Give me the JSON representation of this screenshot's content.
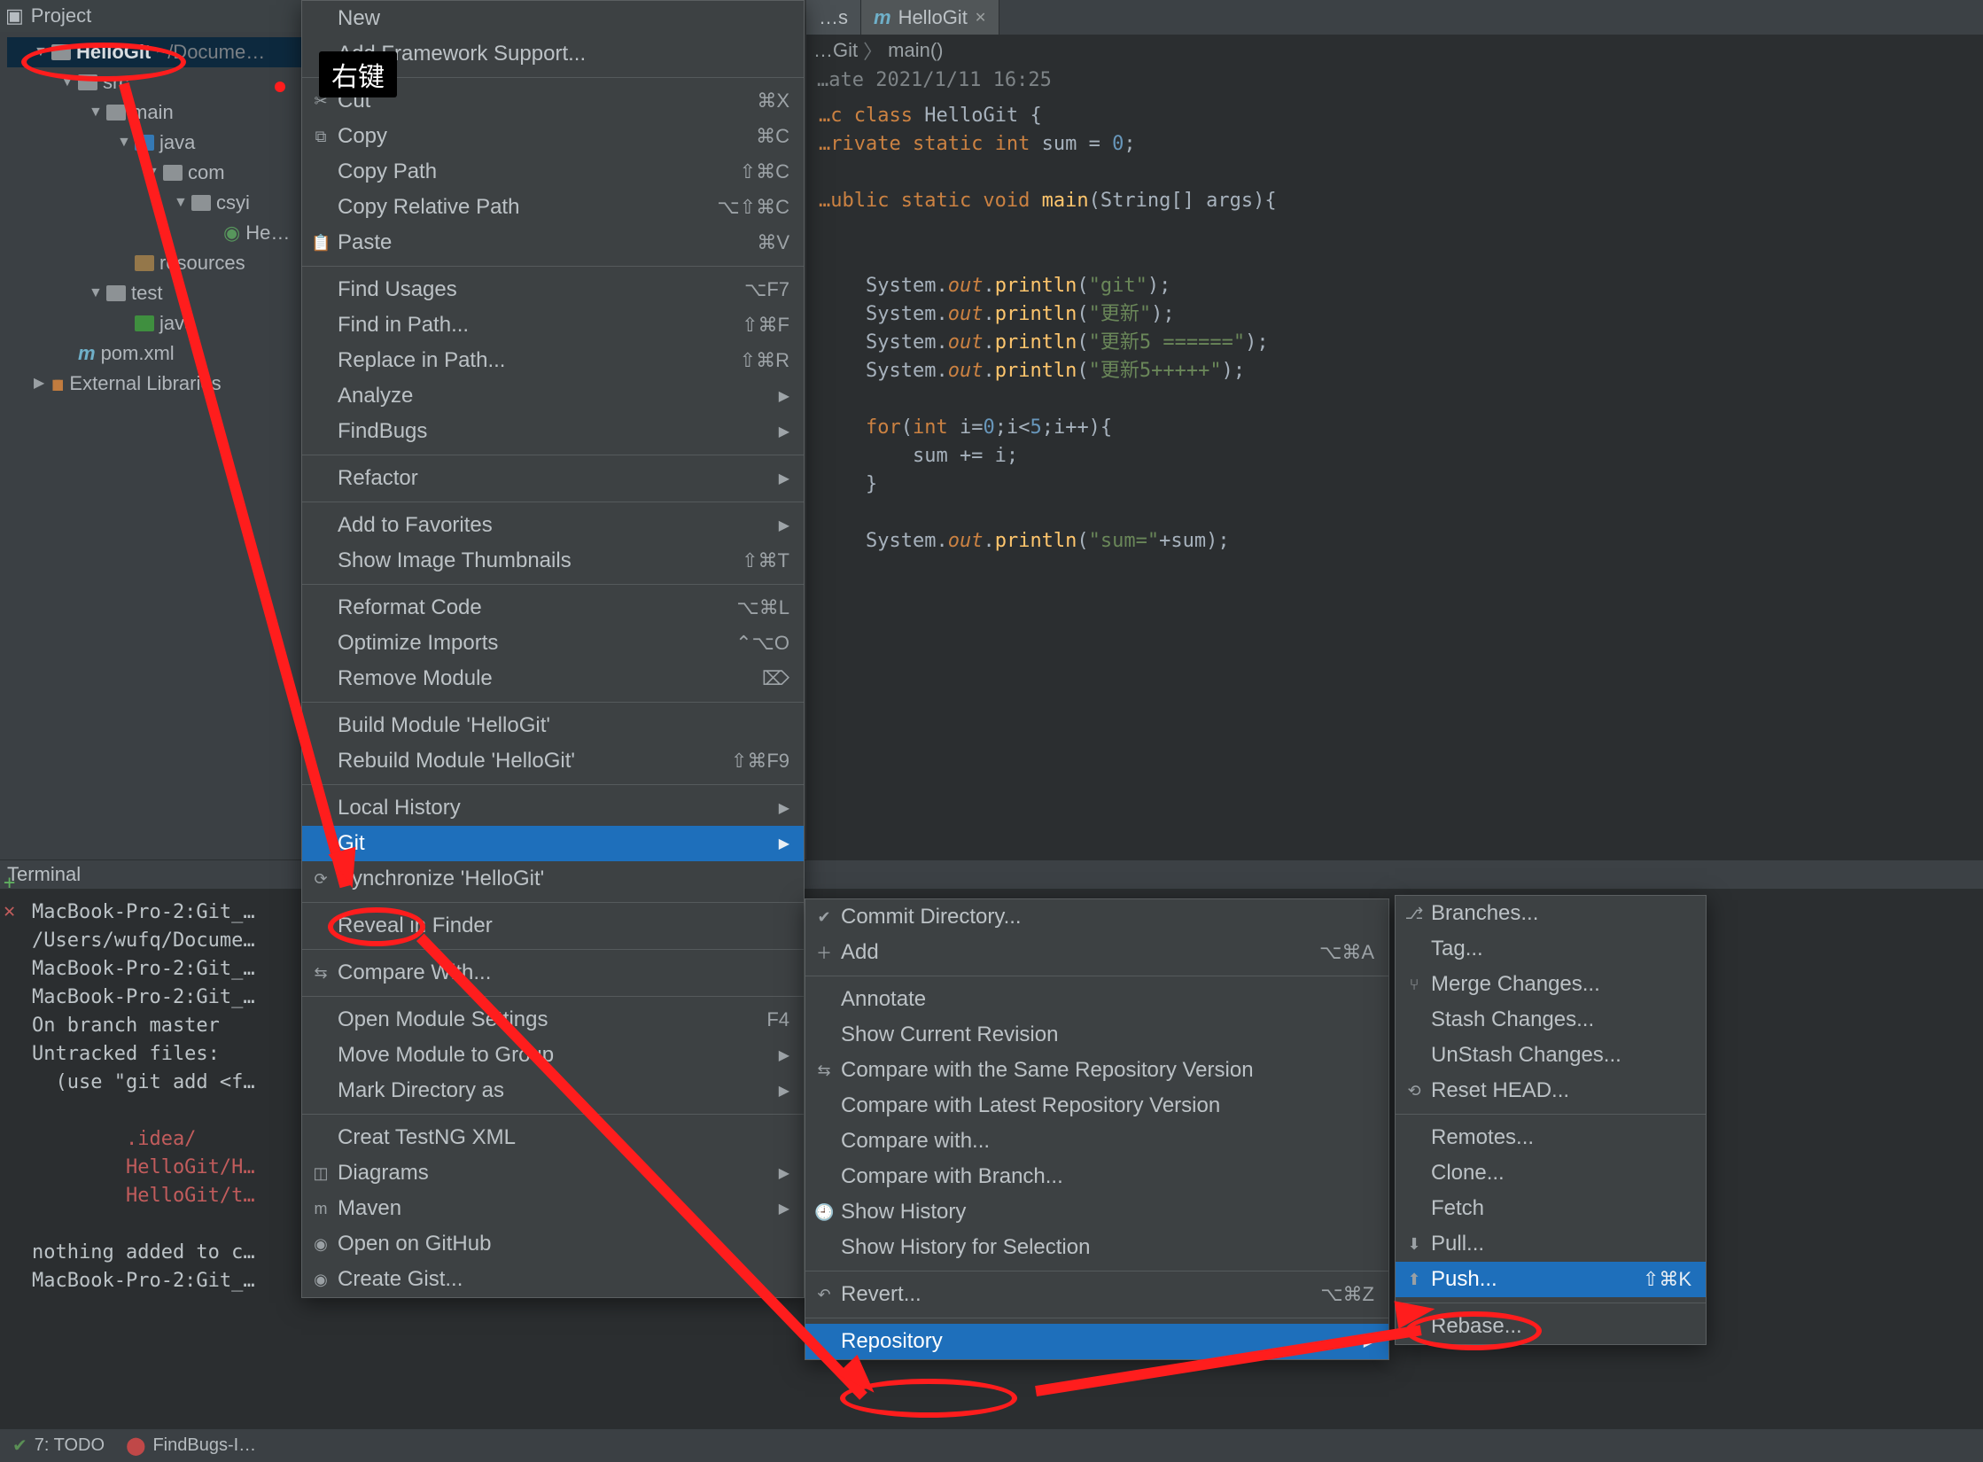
{
  "annotation": {
    "right_click_label": "右键"
  },
  "project_panel": {
    "title": "Project",
    "tree": {
      "root_name": "HelloGit",
      "root_path": "~/Docume…",
      "src": "src",
      "main": "main",
      "java_main": "java",
      "com": "com",
      "csyi": "csyi",
      "hello_file": "He…",
      "resources": "resources",
      "test": "test",
      "java_test": "java",
      "pom": "pom.xml",
      "ext_libs": "External Libraries"
    }
  },
  "editor": {
    "tab1": "…s",
    "tab2": "HelloGit",
    "breadcrumb1": "…Git",
    "breadcrumb2": "main()",
    "meta": "…ate  2021/1/11 16:25",
    "code_lines": [
      {
        "seg": [
          [
            "…c class ",
            "k"
          ],
          [
            "HelloGit ",
            "cls"
          ],
          [
            "{",
            "p"
          ]
        ]
      },
      {
        "seg": [
          [
            "…rivate static ",
            "k"
          ],
          [
            "int ",
            "k"
          ],
          [
            "sum",
            "t"
          ],
          [
            " = ",
            "p"
          ],
          [
            "0",
            "n"
          ],
          [
            ";",
            "p"
          ]
        ]
      },
      {
        "seg": [
          [
            "",
            "p"
          ]
        ]
      },
      {
        "seg": [
          [
            "…ublic static void ",
            "k"
          ],
          [
            "main",
            "m"
          ],
          [
            "(",
            "p"
          ],
          [
            "String",
            "t"
          ],
          [
            "[] ",
            "p"
          ],
          [
            "args",
            "t"
          ],
          [
            "){",
            "p"
          ]
        ]
      },
      {
        "seg": [
          [
            "",
            "p"
          ]
        ]
      },
      {
        "seg": [
          [
            "",
            "p"
          ]
        ]
      },
      {
        "seg": [
          [
            "    System.",
            "t"
          ],
          [
            "out",
            "fld"
          ],
          [
            ".",
            "p"
          ],
          [
            "println",
            "m"
          ],
          [
            "(",
            "p"
          ],
          [
            "\"git\"",
            "s"
          ],
          [
            ");",
            "p"
          ]
        ]
      },
      {
        "seg": [
          [
            "    System.",
            "t"
          ],
          [
            "out",
            "fld"
          ],
          [
            ".",
            "p"
          ],
          [
            "println",
            "m"
          ],
          [
            "(",
            "p"
          ],
          [
            "\"更新\"",
            "s"
          ],
          [
            ");",
            "p"
          ]
        ]
      },
      {
        "seg": [
          [
            "    System.",
            "t"
          ],
          [
            "out",
            "fld"
          ],
          [
            ".",
            "p"
          ],
          [
            "println",
            "m"
          ],
          [
            "(",
            "p"
          ],
          [
            "\"更新5 ======\"",
            "s"
          ],
          [
            ");",
            "p"
          ]
        ]
      },
      {
        "seg": [
          [
            "    System.",
            "t"
          ],
          [
            "out",
            "fld"
          ],
          [
            ".",
            "p"
          ],
          [
            "println",
            "m"
          ],
          [
            "(",
            "p"
          ],
          [
            "\"更新5+++++\"",
            "s"
          ],
          [
            ");",
            "p"
          ]
        ]
      },
      {
        "seg": [
          [
            "",
            "p"
          ]
        ]
      },
      {
        "seg": [
          [
            "    for",
            "k"
          ],
          [
            "(",
            "p"
          ],
          [
            "int ",
            "k"
          ],
          [
            "i=",
            "t"
          ],
          [
            "0",
            "n"
          ],
          [
            ";i<",
            "p"
          ],
          [
            "5",
            "n"
          ],
          [
            ";i++){",
            "p"
          ]
        ]
      },
      {
        "seg": [
          [
            "        sum += i;",
            "t"
          ]
        ]
      },
      {
        "seg": [
          [
            "    }",
            "p"
          ]
        ]
      },
      {
        "seg": [
          [
            "",
            "p"
          ]
        ]
      },
      {
        "seg": [
          [
            "    System.",
            "t"
          ],
          [
            "out",
            "fld"
          ],
          [
            ".",
            "p"
          ],
          [
            "println",
            "m"
          ],
          [
            "(",
            "p"
          ],
          [
            "\"sum=\"",
            "s"
          ],
          [
            "+sum);",
            "p"
          ]
        ]
      }
    ]
  },
  "context_main": [
    {
      "label": "New",
      "shortcut": "",
      "arrow": false,
      "icon": ""
    },
    {
      "label": "Add Framework Support...",
      "shortcut": "",
      "arrow": false,
      "icon": ""
    },
    {
      "sep": true
    },
    {
      "label": "Cut",
      "shortcut": "⌘X",
      "icon": "cut"
    },
    {
      "label": "Copy",
      "shortcut": "⌘C",
      "icon": "copy"
    },
    {
      "label": "Copy Path",
      "shortcut": "⇧⌘C",
      "icon": ""
    },
    {
      "label": "Copy Relative Path",
      "shortcut": "⌥⇧⌘C",
      "icon": ""
    },
    {
      "label": "Paste",
      "shortcut": "⌘V",
      "icon": "paste"
    },
    {
      "sep": true
    },
    {
      "label": "Find Usages",
      "shortcut": "⌥F7",
      "icon": ""
    },
    {
      "label": "Find in Path...",
      "shortcut": "⇧⌘F",
      "icon": ""
    },
    {
      "label": "Replace in Path...",
      "shortcut": "⇧⌘R",
      "icon": ""
    },
    {
      "label": "Analyze",
      "arrow": true,
      "icon": ""
    },
    {
      "label": "FindBugs",
      "arrow": true,
      "icon": ""
    },
    {
      "sep": true
    },
    {
      "label": "Refactor",
      "arrow": true,
      "icon": ""
    },
    {
      "sep": true
    },
    {
      "label": "Add to Favorites",
      "arrow": true,
      "icon": ""
    },
    {
      "label": "Show Image Thumbnails",
      "shortcut": "⇧⌘T",
      "icon": ""
    },
    {
      "sep": true
    },
    {
      "label": "Reformat Code",
      "shortcut": "⌥⌘L",
      "icon": ""
    },
    {
      "label": "Optimize Imports",
      "shortcut": "⌃⌥O",
      "icon": ""
    },
    {
      "label": "Remove Module",
      "shortcut": "⌦",
      "icon": ""
    },
    {
      "sep": true
    },
    {
      "label": "Build Module 'HelloGit'",
      "shortcut": "",
      "icon": ""
    },
    {
      "label": "Rebuild Module 'HelloGit'",
      "shortcut": "⇧⌘F9",
      "icon": ""
    },
    {
      "sep": true
    },
    {
      "label": "Local History",
      "arrow": true,
      "icon": ""
    },
    {
      "label": "Git",
      "arrow": true,
      "icon": "",
      "hl": true
    },
    {
      "label": "Synchronize 'HelloGit'",
      "shortcut": "",
      "icon": "sync"
    },
    {
      "sep": true
    },
    {
      "label": "Reveal in Finder",
      "shortcut": "",
      "icon": ""
    },
    {
      "sep": true
    },
    {
      "label": "Compare With...",
      "shortcut": "",
      "icon": "diff"
    },
    {
      "sep": true
    },
    {
      "label": "Open Module Settings",
      "shortcut": "F4",
      "icon": ""
    },
    {
      "label": "Move Module to Group",
      "arrow": true,
      "icon": ""
    },
    {
      "label": "Mark Directory as",
      "arrow": true,
      "icon": ""
    },
    {
      "sep": true
    },
    {
      "label": "Creat TestNG XML",
      "shortcut": "",
      "icon": ""
    },
    {
      "label": "Diagrams",
      "arrow": true,
      "icon": "diagram"
    },
    {
      "label": "Maven",
      "arrow": true,
      "icon": "maven"
    },
    {
      "label": "Open on GitHub",
      "shortcut": "",
      "icon": "github"
    },
    {
      "label": "Create Gist...",
      "shortcut": "",
      "icon": "github"
    }
  ],
  "context_git": [
    {
      "label": "Commit Directory...",
      "icon": "commit"
    },
    {
      "label": "Add",
      "shortcut": "⌥⌘A",
      "icon": "add"
    },
    {
      "sep": true
    },
    {
      "label": "Annotate",
      "icon": ""
    },
    {
      "label": "Show Current Revision",
      "icon": ""
    },
    {
      "label": "Compare with the Same Repository Version",
      "icon": "diff"
    },
    {
      "label": "Compare with Latest Repository Version",
      "icon": ""
    },
    {
      "label": "Compare with...",
      "icon": ""
    },
    {
      "label": "Compare with Branch...",
      "icon": ""
    },
    {
      "label": "Show History",
      "icon": "history"
    },
    {
      "label": "Show History for Selection",
      "icon": ""
    },
    {
      "sep": true
    },
    {
      "label": "Revert...",
      "shortcut": "⌥⌘Z",
      "icon": "revert"
    },
    {
      "sep": true
    },
    {
      "label": "Repository",
      "arrow": true,
      "hl": true,
      "icon": ""
    }
  ],
  "context_repo": [
    {
      "label": "Branches...",
      "icon": "branch"
    },
    {
      "label": "Tag...",
      "icon": ""
    },
    {
      "label": "Merge Changes...",
      "icon": "merge"
    },
    {
      "label": "Stash Changes...",
      "icon": ""
    },
    {
      "label": "UnStash Changes...",
      "icon": ""
    },
    {
      "label": "Reset HEAD...",
      "icon": "reset"
    },
    {
      "sep": true
    },
    {
      "label": "Remotes...",
      "icon": ""
    },
    {
      "label": "Clone...",
      "icon": ""
    },
    {
      "label": "Fetch",
      "icon": ""
    },
    {
      "label": "Pull...",
      "icon": "pull"
    },
    {
      "label": "Push...",
      "shortcut": "⇧⌘K",
      "icon": "push",
      "hl": true
    },
    {
      "sep": true
    },
    {
      "label": "Rebase...",
      "icon": ""
    }
  ],
  "terminal": {
    "title": "Terminal",
    "lines": [
      {
        "cls": "",
        "txt": "MacBook-Pro-2:Git_…"
      },
      {
        "cls": "",
        "txt": "/Users/wufq/Docume…"
      },
      {
        "cls": "",
        "txt": "MacBook-Pro-2:Git_…"
      },
      {
        "cls": "",
        "txt": "MacBook-Pro-2:Git_…"
      },
      {
        "cls": "",
        "txt": "On branch master"
      },
      {
        "cls": "",
        "txt": "Untracked files:"
      },
      {
        "cls": "",
        "txt": "  (use \"git add <f…"
      },
      {
        "cls": "",
        "txt": ""
      },
      {
        "cls": "term-redfn",
        "txt": "        .idea/"
      },
      {
        "cls": "term-redfn",
        "txt": "        HelloGit/H…"
      },
      {
        "cls": "term-redfn",
        "txt": "        HelloGit/t…"
      },
      {
        "cls": "",
        "txt": ""
      },
      {
        "cls": "",
        "txt": "nothing added to c…"
      },
      {
        "cls": "",
        "txt": "MacBook-Pro-2:Git_…"
      }
    ]
  },
  "status": {
    "todo": "7: TODO",
    "findbugs": "FindBugs-I…"
  }
}
